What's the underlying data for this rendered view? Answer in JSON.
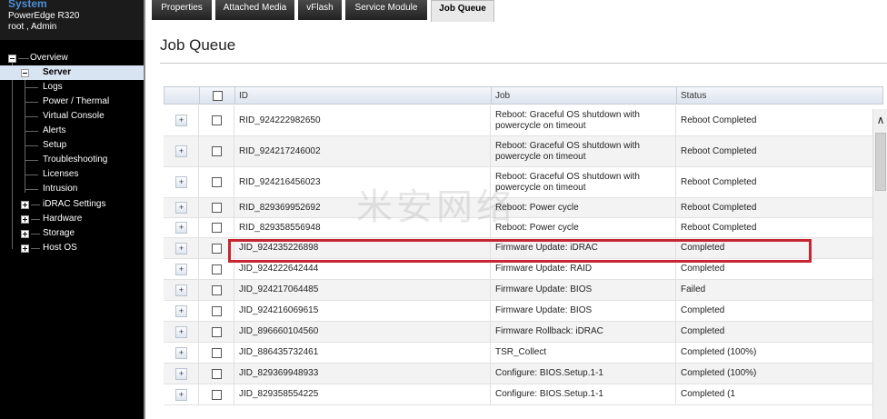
{
  "system": {
    "title": "System",
    "model": "PowerEdge R320",
    "user": "root , Admin"
  },
  "tree": {
    "overview": "Overview",
    "server": "Server",
    "server_children": [
      "Logs",
      "Power / Thermal",
      "Virtual Console",
      "Alerts",
      "Setup",
      "Troubleshooting",
      "Licenses",
      "Intrusion"
    ],
    "collapsed": [
      "iDRAC Settings",
      "Hardware",
      "Storage",
      "Host OS"
    ]
  },
  "tabs": [
    "Properties",
    "Attached Media",
    "vFlash",
    "Service Module",
    "Job Queue"
  ],
  "active_tab": "Job Queue",
  "page_title": "Job Queue",
  "table": {
    "columns": {
      "id": "ID",
      "job": "Job",
      "status": "Status"
    },
    "rows": [
      {
        "id": "RID_924222982650",
        "job": "Reboot: Graceful OS shutdown with powercycle on timeout",
        "status": "Reboot Completed"
      },
      {
        "id": "RID_924217246002",
        "job": "Reboot: Graceful OS shutdown with powercycle on timeout",
        "status": "Reboot Completed"
      },
      {
        "id": "RID_924216456023",
        "job": "Reboot: Graceful OS shutdown with powercycle on timeout",
        "status": "Reboot Completed"
      },
      {
        "id": "RID_829369952692",
        "job": "Reboot: Power cycle",
        "status": "Reboot Completed"
      },
      {
        "id": "RID_829358556948",
        "job": "Reboot: Power cycle",
        "status": "Reboot Completed"
      },
      {
        "id": "JID_924235226898",
        "job": "Firmware Update: iDRAC",
        "status": "Completed"
      },
      {
        "id": "JID_924222642444",
        "job": "Firmware Update: RAID",
        "status": "Completed"
      },
      {
        "id": "JID_924217064485",
        "job": "Firmware Update: BIOS",
        "status": "Failed"
      },
      {
        "id": "JID_924216069615",
        "job": "Firmware Update: BIOS",
        "status": "Completed"
      },
      {
        "id": "JID_896660104560",
        "job": "Firmware Rollback: iDRAC",
        "status": "Completed"
      },
      {
        "id": "JID_886435732461",
        "job": "TSR_Collect",
        "status": "Completed (100%)"
      },
      {
        "id": "JID_829369948933",
        "job": "Configure: BIOS.Setup.1-1",
        "status": "Completed (100%)"
      },
      {
        "id": "JID_829358554225",
        "job": "Configure: BIOS.Setup.1-1",
        "status": "Completed (1"
      }
    ]
  },
  "watermark": "米安网络",
  "colors": {
    "highlight": "#c62631",
    "sidebar_bg": "#000000",
    "selected_bg": "#d9e4f3"
  }
}
